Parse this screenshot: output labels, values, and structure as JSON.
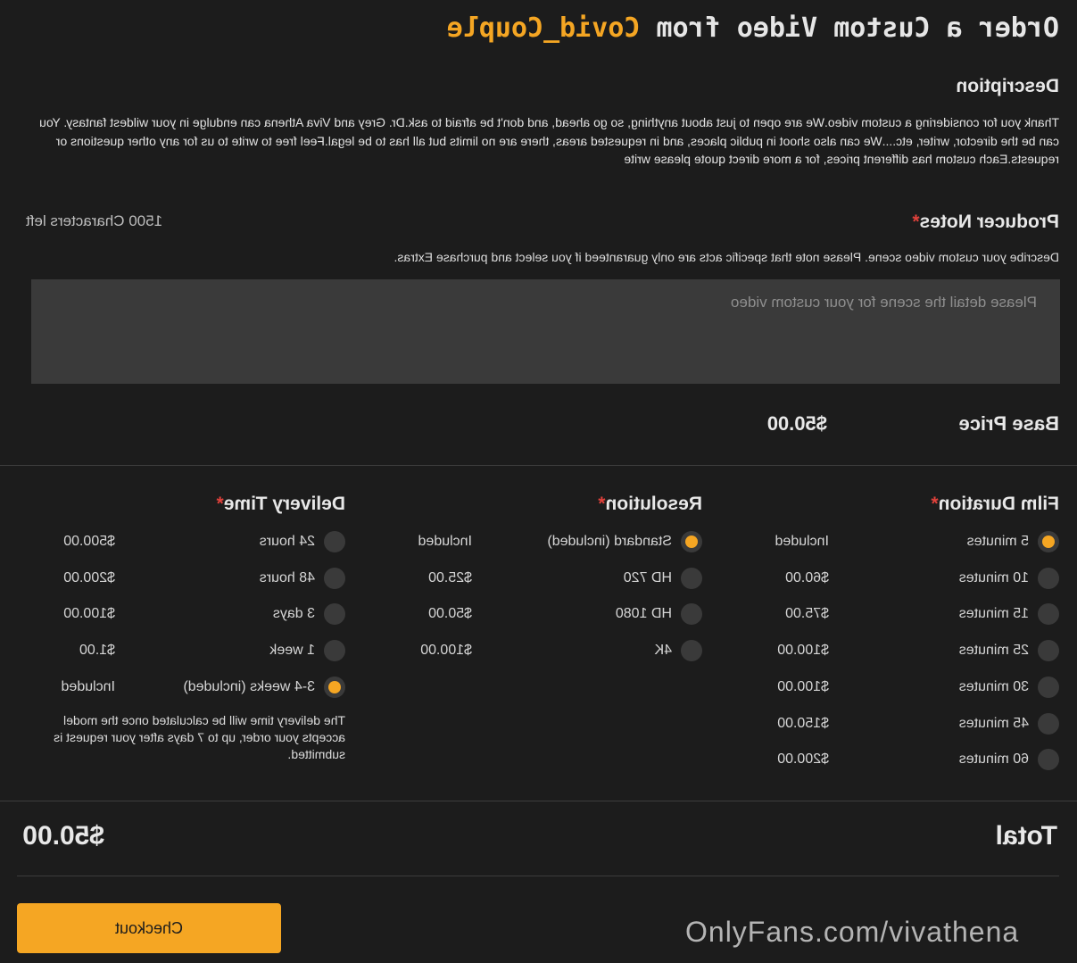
{
  "header": {
    "title_prefix": "Order a Custom Video from ",
    "creator": "Covid_Couple"
  },
  "description": {
    "heading": "Description",
    "text": "Thank you for considering a custom video.We are open to just about anything, so go ahead, and don't be afraid to ask.Dr. Grey and Viva Athena can endulge in your wildest fantasy. You can be the director, writer, etc....We can also shoot in public places, and in requested areas, there are no limits but all has to be legal.Feel free to write to us for any other questions or requests.Each custom has different prices, for a more direct quote please write"
  },
  "producer_notes": {
    "heading": "Producer Notes",
    "required_mark": "*",
    "chars_left": "1500 Characters left",
    "hint": "Describe your custom video scene. Please note that specific acts are only guaranteed if you select and purchase Extras.",
    "placeholder": "Please detail the scene for your custom video",
    "value": ""
  },
  "base_price": {
    "label": "Base Price",
    "value": "$50.00"
  },
  "film_duration": {
    "heading": "Film Duration",
    "required_mark": "*",
    "options": [
      {
        "label": "5 minutes",
        "price": "Included",
        "selected": true
      },
      {
        "label": "10 minutes",
        "price": "$60.00",
        "selected": false
      },
      {
        "label": "15 minutes",
        "price": "$75.00",
        "selected": false
      },
      {
        "label": "25 minutes",
        "price": "$100.00",
        "selected": false
      },
      {
        "label": "30 minutes",
        "price": "$100.00",
        "selected": false
      },
      {
        "label": "45 minutes",
        "price": "$150.00",
        "selected": false
      },
      {
        "label": "60 minutes",
        "price": "$200.00",
        "selected": false
      }
    ]
  },
  "resolution": {
    "heading": "Resolution",
    "required_mark": "*",
    "options": [
      {
        "label": "Standard (included)",
        "price": "Included",
        "selected": true
      },
      {
        "label": "HD 720",
        "price": "$25.00",
        "selected": false
      },
      {
        "label": "HD 1080",
        "price": "$50.00",
        "selected": false
      },
      {
        "label": "4K",
        "price": "$100.00",
        "selected": false
      }
    ]
  },
  "delivery_time": {
    "heading": "Delivery Time",
    "required_mark": "*",
    "options": [
      {
        "label": "24 hours",
        "price": "$500.00",
        "selected": false
      },
      {
        "label": "48 hours",
        "price": "$200.00",
        "selected": false
      },
      {
        "label": "3 days",
        "price": "$100.00",
        "selected": false
      },
      {
        "label": "1 week",
        "price": "$1.00",
        "selected": false
      },
      {
        "label": "3-4 weeks (included)",
        "price": "Included",
        "selected": true
      }
    ],
    "note": "The delivery time will be calculated once the model accepts your order, up to 7 days after your request is submitted."
  },
  "total": {
    "label": "Total",
    "value": "$50.00"
  },
  "checkout_label": "Checkout",
  "watermark": "OnlyFans.com/vivathena",
  "colors": {
    "background": "#1c1c1c",
    "accent": "#f5a623",
    "input_bg": "#3a3a3a",
    "required": "#e0413b"
  }
}
